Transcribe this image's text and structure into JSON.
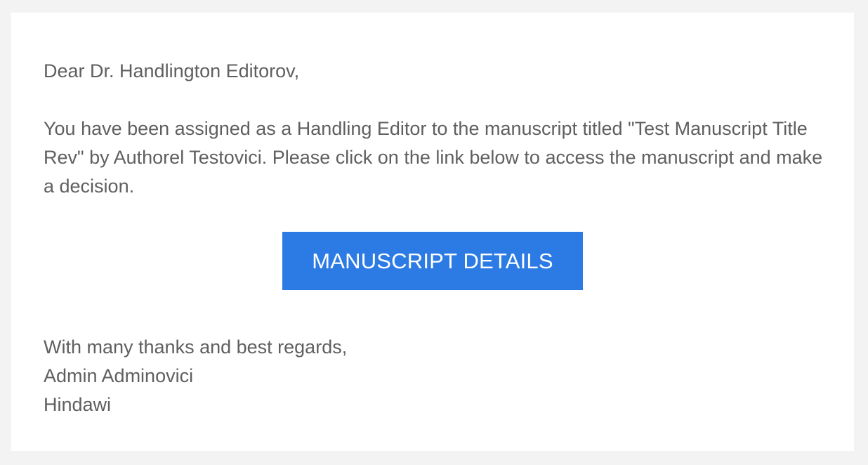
{
  "email": {
    "greeting": "Dear Dr. Handlington Editorov,",
    "body": "You have been assigned as a Handling Editor to the manuscript titled \"Test Manuscript Title Rev\" by Authorel Testovici. Please click on the link below to access the manuscript and make a decision.",
    "button_label": "MANUSCRIPT DETAILS",
    "closing": "With many thanks and best regards,",
    "sender_name": "Admin Adminovici",
    "sender_org": "Hindawi"
  },
  "colors": {
    "page_background": "#f3f3f3",
    "card_background": "#ffffff",
    "text": "#5f5f5f",
    "button_background": "#2c7be5",
    "button_text": "#ffffff"
  }
}
